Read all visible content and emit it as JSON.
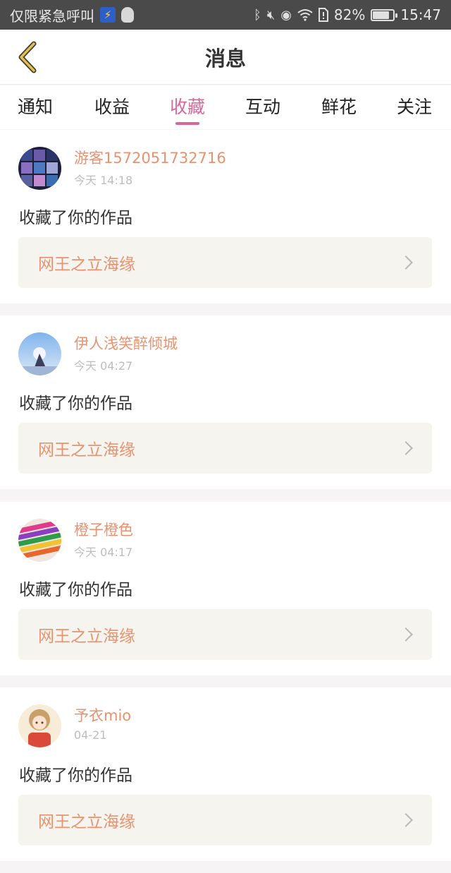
{
  "status_bar": {
    "carrier_text": "仅限紧急呼叫",
    "battery_percent": "82%",
    "battery_level": 0.82,
    "time": "15:47",
    "icons": [
      "flash-badge-icon",
      "qq-penguin-icon",
      "bluetooth-icon",
      "mute-icon",
      "eye-icon",
      "wifi-icon",
      "sim-icon",
      "battery-icon"
    ]
  },
  "header": {
    "title": "消息",
    "back_icon": "chevron-left-icon"
  },
  "tabs": [
    {
      "label": "通知",
      "active": false
    },
    {
      "label": "收益",
      "active": false
    },
    {
      "label": "收藏",
      "active": true
    },
    {
      "label": "互动",
      "active": false
    },
    {
      "label": "鲜花",
      "active": false
    },
    {
      "label": "关注",
      "active": false
    }
  ],
  "messages": [
    {
      "user": "游客1572051732716",
      "time": "今天 14:18",
      "action": "收藏了你的作品",
      "work": "网王之立海缘"
    },
    {
      "user": "伊人浅笑醉倾城",
      "time": "今天 04:27",
      "action": "收藏了你的作品",
      "work": "网王之立海缘"
    },
    {
      "user": "橙子橙色",
      "time": "今天 04:17",
      "action": "收藏了你的作品",
      "work": "网王之立海缘"
    },
    {
      "user": "予衣mio",
      "time": "04-21",
      "action": "收藏了你的作品",
      "work": "网王之立海缘"
    }
  ],
  "colors": {
    "accent": "#d9679c",
    "name_color": "#e89270",
    "back_icon_color": "#e2c04a",
    "separator": "#f6f4f4"
  }
}
